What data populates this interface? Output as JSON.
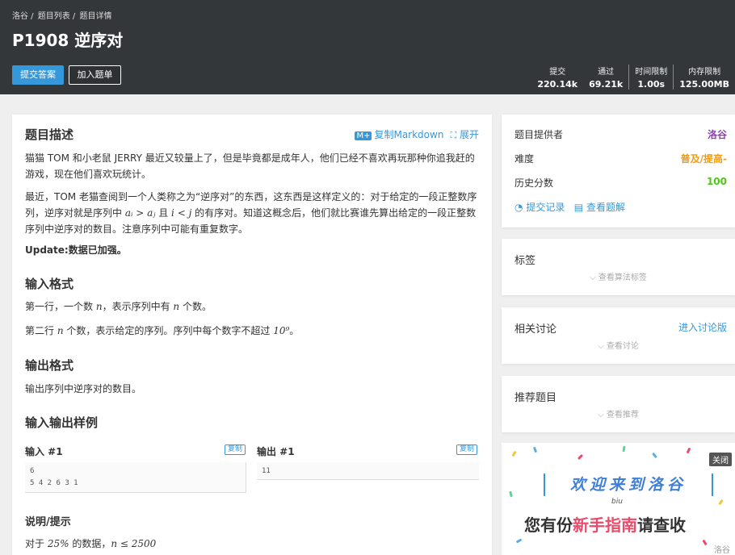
{
  "header": {
    "breadcrumb": [
      "洛谷 /",
      "题目列表 /",
      "题目详情"
    ],
    "title": "P1908 逆序对",
    "submit_label": "提交答案",
    "add_label": "加入题单",
    "stats": [
      {
        "label": "提交",
        "value": "220.14k"
      },
      {
        "label": "通过",
        "value": "69.21k"
      },
      {
        "label": "时间限制",
        "value": "1.00s"
      },
      {
        "label": "内存限制",
        "value": "125.00MB"
      }
    ]
  },
  "problem": {
    "desc_title": "题目描述",
    "copy_markdown": "复制Markdown",
    "expand": "展开",
    "p1": "猫猫 TOM 和小老鼠 JERRY 最近又较量上了，但是毕竟都是成年人，他们已经不喜欢再玩那种你追我赶的游戏，现在他们喜欢玩统计。",
    "p2_a": "最近，TOM 老猫查阅到一个人类称之为“逆序对”的东西，这东西是这样定义的：对于给定的一段正整数序列，逆序对就是序列中 ",
    "p2_math1": "aᵢ > aⱼ",
    "p2_b": " 且 ",
    "p2_math2": "i < j",
    "p2_c": " 的有序对。知道这概念后，他们就比赛谁先算出给定的一段正整数序列中逆序对的数目。注意序列中可能有重复数字。",
    "update": "Update:数据已加强。",
    "input_title": "输入格式",
    "input_1a": "第一行，一个数 ",
    "input_1m": "n",
    "input_1b": "，表示序列中有 ",
    "input_1m2": "n",
    "input_1c": " 个数。",
    "input_2a": "第二行 ",
    "input_2m": "n",
    "input_2b": " 个数，表示给定的序列。序列中每个数字不超过 ",
    "input_2m2": "10⁹",
    "input_2c": "。",
    "output_title": "输出格式",
    "output_text": "输出序列中逆序对的数目。",
    "sample_title": "输入输出样例",
    "in_label": "输入 #1",
    "out_label": "输出 #1",
    "copy": "复制",
    "in_code": "6\n5 4 2 6 3 1",
    "out_code": "11",
    "hint_title": "说明/提示",
    "hint_a": "对于 ",
    "hint_m1": "25%",
    "hint_b": " 的数据，",
    "hint_m2": "n ≤ 2500"
  },
  "info": {
    "provider_label": "题目提供者",
    "provider_value": "洛谷",
    "difficulty_label": "难度",
    "difficulty_value": "普及/提高-",
    "score_label": "历史分数",
    "score_value": "100",
    "submissions_link": "提交记录",
    "solutions_link": "查看题解"
  },
  "tags": {
    "title": "标签",
    "hint": "查看算法标签"
  },
  "discuss": {
    "title": "相关讨论",
    "link": "进入讨论版",
    "hint": "查看讨论"
  },
  "recommend": {
    "title": "推荐题目",
    "hint": "查看推荐"
  },
  "banner": {
    "line1": "欢迎来到洛谷",
    "biu": "biu",
    "line2_a": "您有份",
    "line2_hl": "新手指南",
    "line2_b": "请查收",
    "close": "关闭",
    "logo": "洛谷"
  },
  "colors": {
    "accent": "#3498db",
    "header_bg": "#34373a",
    "provider": "#8e44ad",
    "difficulty": "#f39c11",
    "score": "#52c41a"
  }
}
